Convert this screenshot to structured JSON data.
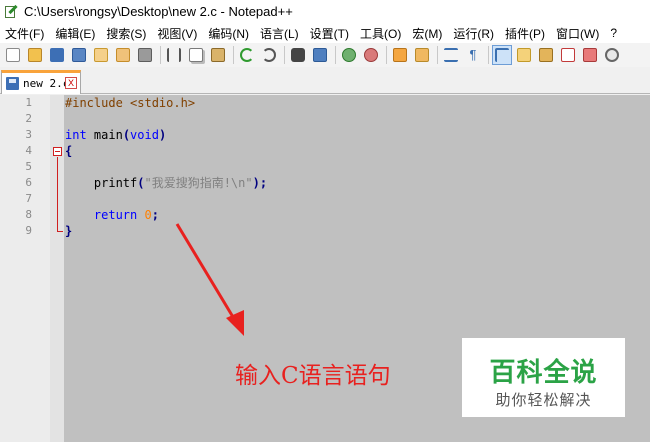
{
  "window": {
    "title": "C:\\Users\\rongsy\\Desktop\\new 2.c - Notepad++"
  },
  "menu": [
    "文件(F)",
    "编辑(E)",
    "搜索(S)",
    "视图(V)",
    "编码(N)",
    "语言(L)",
    "设置(T)",
    "工具(O)",
    "宏(M)",
    "运行(R)",
    "插件(P)",
    "窗口(W)",
    "?"
  ],
  "toolbar": {
    "icons": [
      "new-file-icon",
      "open-file-icon",
      "save-icon",
      "save-all-icon",
      "close-icon",
      "close-all-icon",
      "print-icon",
      "cut-icon",
      "copy-icon",
      "paste-icon",
      "undo-icon",
      "redo-icon",
      "find-icon",
      "replace-icon",
      "zoom-in-icon",
      "zoom-out-icon",
      "sync-vertical-icon",
      "sync-horizontal-icon",
      "word-wrap-icon",
      "show-all-chars-icon",
      "indent-guide-icon",
      "user-lang-icon",
      "doc-map-icon",
      "function-list-icon",
      "folder-workspace-icon",
      "monitor-icon"
    ],
    "active_icon": "indent-guide-icon"
  },
  "tab": {
    "label": "new 2.c",
    "close_glyph": "X"
  },
  "editor": {
    "line_numbers": [
      "1",
      "2",
      "3",
      "4",
      "5",
      "6",
      "7",
      "8",
      "9"
    ],
    "current_line": 9,
    "lines": [
      [
        {
          "t": "#include <stdio.h>",
          "c": "pre"
        }
      ],
      [],
      [
        {
          "t": "int",
          "c": "kw"
        },
        {
          "t": " main",
          "c": "plain"
        },
        {
          "t": "(",
          "c": "op"
        },
        {
          "t": "void",
          "c": "kw"
        },
        {
          "t": ")",
          "c": "op"
        }
      ],
      [
        {
          "t": "{",
          "c": "op"
        }
      ],
      [],
      [
        {
          "t": "    printf",
          "c": "plain"
        },
        {
          "t": "(",
          "c": "op"
        },
        {
          "t": "\"我爱搜狗指南!\\n\"",
          "c": "str"
        },
        {
          "t": ");",
          "c": "op"
        }
      ],
      [],
      [
        {
          "t": "    return",
          "c": "kw"
        },
        {
          "t": " ",
          "c": "plain"
        },
        {
          "t": "0",
          "c": "num"
        },
        {
          "t": ";",
          "c": "op"
        }
      ],
      [
        {
          "t": "}",
          "c": "op"
        }
      ]
    ]
  },
  "annotation": {
    "text": "输入C语言语句",
    "color": "#e8211f"
  },
  "watermark": {
    "title": "百科全说",
    "subtitle": "助你轻松解决"
  }
}
